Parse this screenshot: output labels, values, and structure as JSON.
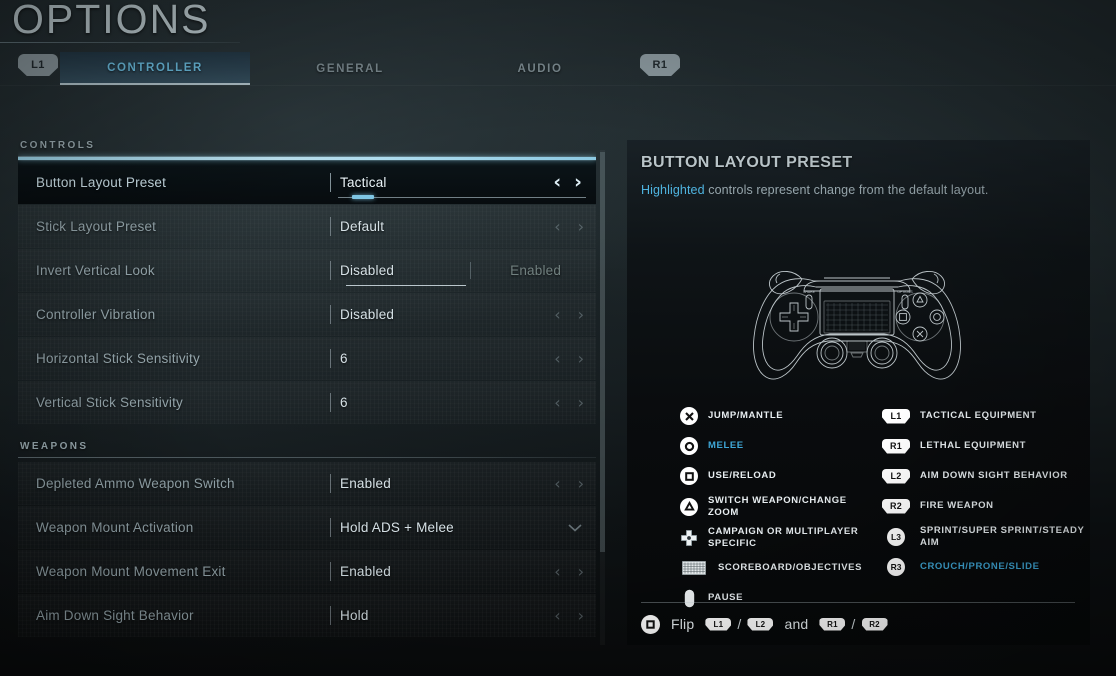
{
  "header": {
    "title": "OPTIONS"
  },
  "tabs": {
    "prev_shoulder": "L1",
    "next_shoulder": "R1",
    "items": [
      {
        "label": "CONTROLLER",
        "active": true
      },
      {
        "label": "GENERAL",
        "active": false
      },
      {
        "label": "AUDIO",
        "active": false
      }
    ]
  },
  "sections": [
    {
      "title": "CONTROLS",
      "rows": [
        {
          "label": "Button Layout Preset",
          "value": "Tactical",
          "control": "stepper",
          "selected": true
        },
        {
          "label": "Stick Layout Preset",
          "value": "Default",
          "control": "stepper",
          "selected": false
        },
        {
          "label": "Invert Vertical Look",
          "value": "Disabled",
          "alt_value": "Enabled",
          "control": "dual",
          "selected": false
        },
        {
          "label": "Controller Vibration",
          "value": "Disabled",
          "control": "stepper",
          "selected": false
        },
        {
          "label": "Horizontal Stick Sensitivity",
          "value": "6",
          "control": "stepper",
          "selected": false
        },
        {
          "label": "Vertical Stick Sensitivity",
          "value": "6",
          "control": "stepper",
          "selected": false
        }
      ]
    },
    {
      "title": "WEAPONS",
      "rows": [
        {
          "label": "Depleted Ammo Weapon Switch",
          "value": "Enabled",
          "control": "stepper",
          "selected": false
        },
        {
          "label": "Weapon Mount Activation",
          "value": "Hold ADS + Melee",
          "control": "dropdown",
          "selected": false
        },
        {
          "label": "Weapon Mount Movement Exit",
          "value": "Enabled",
          "control": "stepper",
          "selected": false
        },
        {
          "label": "Aim Down Sight Behavior",
          "value": "Hold",
          "control": "stepper",
          "selected": false
        }
      ]
    }
  ],
  "icons": {
    "arrow_left": "‹",
    "arrow_right": "›",
    "arrow_left_bold": "‹",
    "arrow_right_bold": "›",
    "chevron_down": "⌵"
  },
  "detail": {
    "title": "BUTTON LAYOUT PRESET",
    "desc_highlight": "Highlighted",
    "desc_rest": " controls represent change from the default layout.",
    "controller_art": "dualshock-controller-wireframe",
    "legend_left": [
      {
        "icon": "cross-button-icon",
        "glyph": "cross",
        "text": "JUMP/MANTLE",
        "highlight": false
      },
      {
        "icon": "circle-button-icon",
        "glyph": "circle",
        "text": "MELEE",
        "highlight": true
      },
      {
        "icon": "square-button-icon",
        "glyph": "square",
        "text": "USE/RELOAD",
        "highlight": false
      },
      {
        "icon": "triangle-button-icon",
        "glyph": "triangle",
        "text": "SWITCH WEAPON/CHANGE ZOOM",
        "highlight": false
      },
      {
        "icon": "dpad-icon",
        "glyph": "dpad",
        "text": "CAMPAIGN OR MULTIPLAYER SPECIFIC",
        "highlight": false
      },
      {
        "icon": "touchpad-icon",
        "glyph": "touchpad",
        "text": "SCOREBOARD/OBJECTIVES",
        "highlight": false
      },
      {
        "icon": "options-button-icon",
        "glyph": "pill",
        "text": "PAUSE",
        "highlight": false
      }
    ],
    "legend_right": [
      {
        "icon": "l1-button-icon",
        "glyph": "shoulder",
        "badge": "L1",
        "text": "TACTICAL EQUIPMENT",
        "highlight": false
      },
      {
        "icon": "r1-button-icon",
        "glyph": "shoulder",
        "badge": "R1",
        "text": "LETHAL EQUIPMENT",
        "highlight": false
      },
      {
        "icon": "l2-button-icon",
        "glyph": "shoulder",
        "badge": "L2",
        "text": "AIM DOWN SIGHT BEHAVIOR",
        "highlight": false
      },
      {
        "icon": "r2-button-icon",
        "glyph": "shoulder",
        "badge": "R2",
        "text": "FIRE WEAPON",
        "highlight": false
      },
      {
        "icon": "l3-button-icon",
        "glyph": "stick",
        "badge": "L3",
        "text": "SPRINT/SUPER SPRINT/STEADY AIM",
        "highlight": false
      },
      {
        "icon": "r3-button-icon",
        "glyph": "stick",
        "badge": "R3",
        "text": "CROUCH/PRONE/SLIDE",
        "highlight": true
      }
    ],
    "flip": {
      "action": "Flip",
      "b1": "L1",
      "sep1": "/",
      "b2": "L2",
      "conj": "and",
      "b3": "R1",
      "sep2": "/",
      "b4": "R2"
    }
  },
  "colors": {
    "accent_cyan": "#4fb4e0",
    "accent_light": "#8cc9e2",
    "text_primary": "#d6e1e6",
    "text_muted": "#97a8ae",
    "panel_bg": "#0c1013"
  }
}
